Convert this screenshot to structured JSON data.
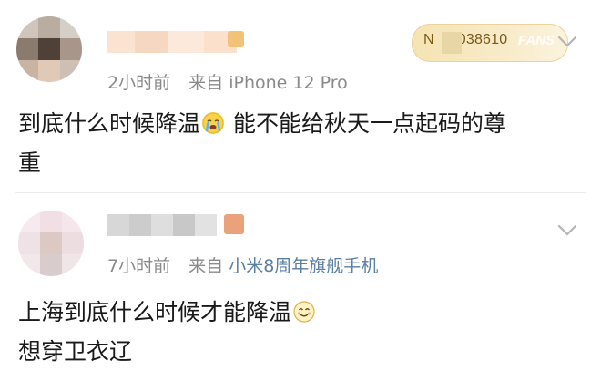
{
  "post1": {
    "time": "2小时前",
    "source_prefix": "来自",
    "source": "iPhone 12 Pro",
    "fans_prefix": "N",
    "fans_number": "038610",
    "fans_label": "FANS",
    "text_line1_a": "到底什么时候降温",
    "text_line1_b": " 能不能给秋天一点起码的尊",
    "text_line2": "重",
    "emoji": "crying-face-emoji"
  },
  "post2": {
    "time": "7小时前",
    "source_prefix": "来自",
    "source": "小米8周年旗舰手机",
    "text_line1": "上海到底什么时候才能降温",
    "text_line2": "想穿卫衣辽",
    "emoji": "smiling-face-emoji"
  },
  "colors": {
    "meta_gray": "#8a8a8a",
    "link_blue": "#5b7ea3",
    "fans_gold": "#f5e3b3",
    "divider": "#ececec"
  }
}
